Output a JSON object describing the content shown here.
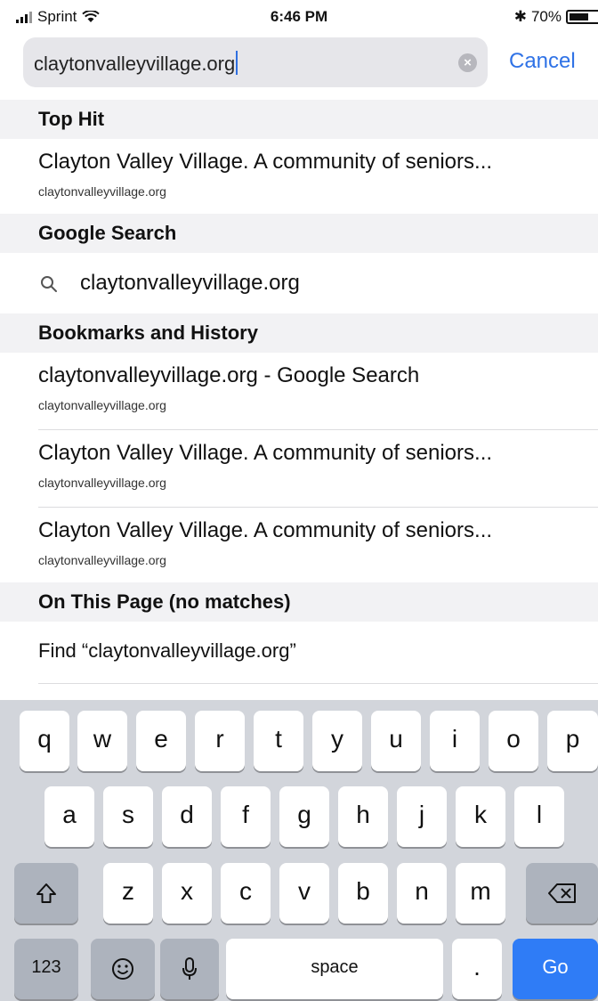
{
  "status_bar": {
    "carrier": "Sprint",
    "time": "6:46 PM",
    "battery": "70%",
    "battery_level": 0.7
  },
  "search": {
    "query": "claytonvalleyvillage.org",
    "cancel_label": "Cancel"
  },
  "sections": {
    "top_hit": "Top Hit",
    "google": "Google Search",
    "bookmarks": "Bookmarks and History",
    "on_page": "On This Page (no matches)"
  },
  "top_hit": {
    "title": "Clayton Valley Village. A community of seniors...",
    "url": "claytonvalleyvillage.org"
  },
  "google_suggestion": "claytonvalleyvillage.org",
  "history": [
    {
      "title": "claytonvalleyvillage.org - Google Search",
      "url": "claytonvalleyvillage.org"
    },
    {
      "title": "Clayton Valley Village. A community of seniors...",
      "url": "claytonvalleyvillage.org"
    },
    {
      "title": "Clayton Valley Village. A community of seniors...",
      "url": "claytonvalleyvillage.org"
    }
  ],
  "find_on_page": "Find “claytonvalleyvillage.org”",
  "keyboard": {
    "row1": [
      "q",
      "w",
      "e",
      "r",
      "t",
      "y",
      "u",
      "i",
      "o",
      "p"
    ],
    "row2": [
      "a",
      "s",
      "d",
      "f",
      "g",
      "h",
      "j",
      "k",
      "l"
    ],
    "row3": [
      "z",
      "x",
      "c",
      "v",
      "b",
      "n",
      "m"
    ],
    "numbers_label": "123",
    "space_label": "space",
    "period_label": ".",
    "go_label": "Go",
    "icons": {
      "shift": "shift-arrow-icon",
      "delete": "delete-backspace-icon",
      "emoji": "emoji-smiley-icon",
      "mic": "microphone-icon"
    }
  },
  "colors": {
    "accent": "#2f72e6",
    "go_key": "#2f7cf6",
    "section_bg": "#f2f2f4",
    "keyboard_bg": "#d2d5db"
  }
}
